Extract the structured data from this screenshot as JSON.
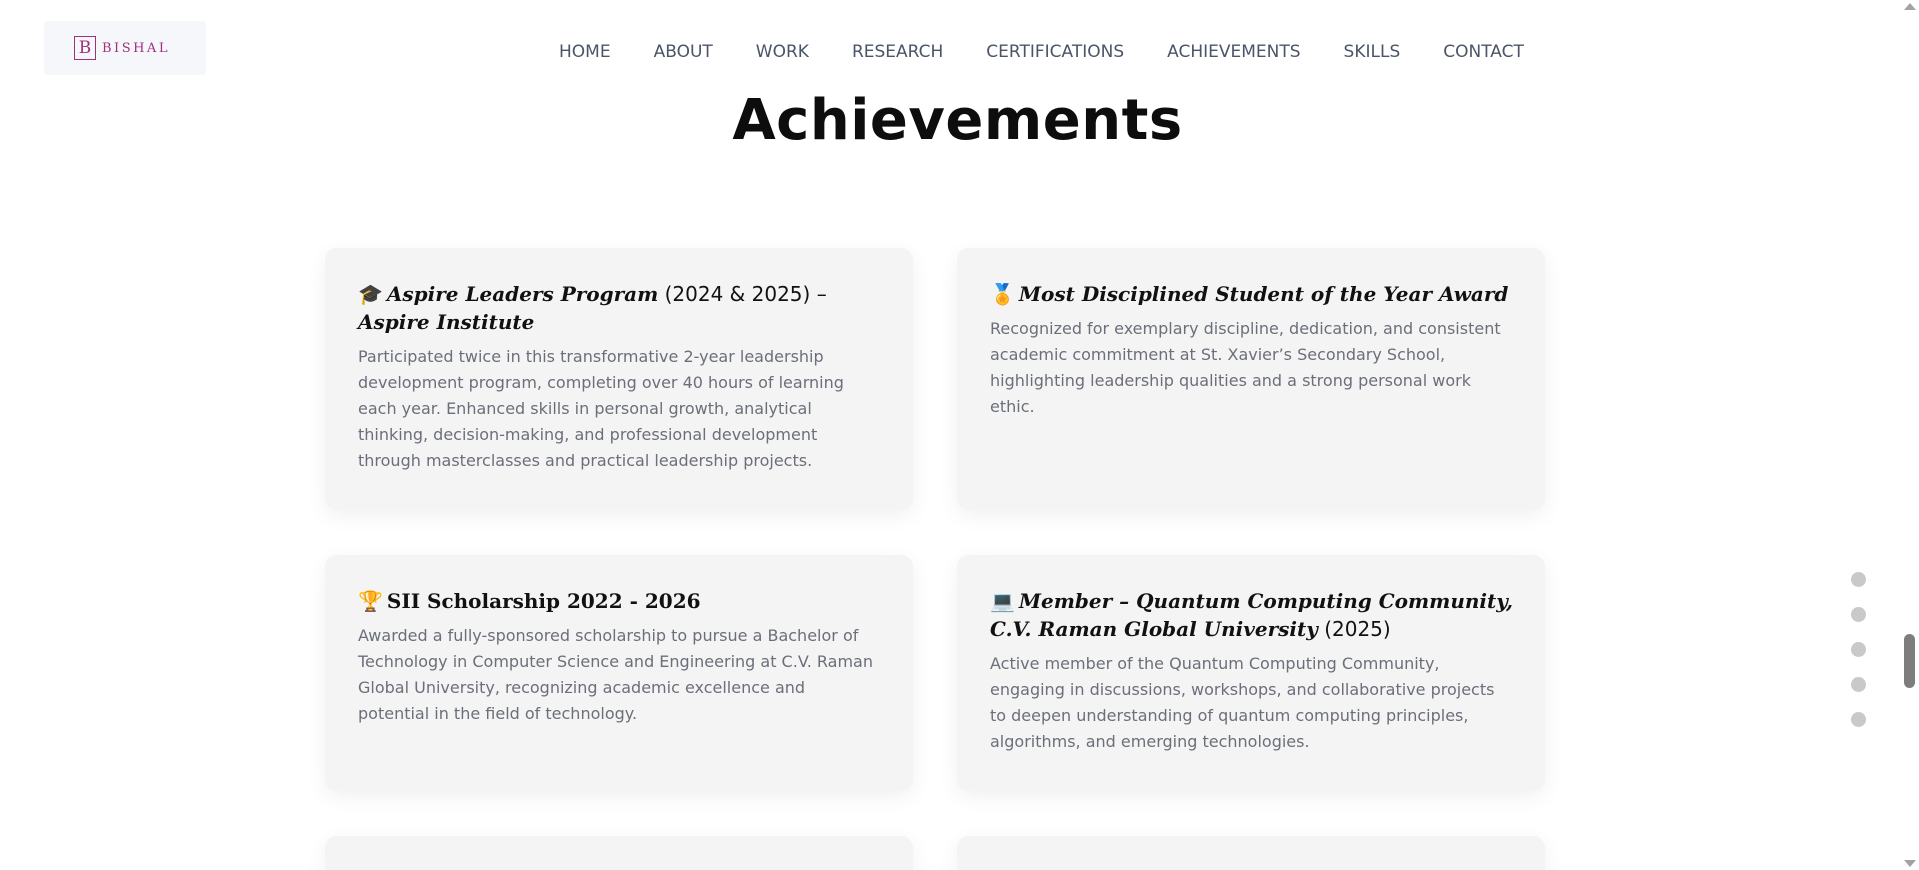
{
  "logo": {
    "letter": "B",
    "text": "BISHAL"
  },
  "nav": {
    "items": [
      "HOME",
      "ABOUT",
      "WORK",
      "RESEARCH",
      "CERTIFICATIONS",
      "ACHIEVEMENTS",
      "SKILLS",
      "CONTACT"
    ]
  },
  "section": {
    "title": "Achievements"
  },
  "cards": [
    {
      "emoji": "🎓",
      "title_italic": "Aspire Leaders Program",
      "title_plain": " (2024 & 2025) –",
      "title_italic2": "Aspire Institute",
      "description": "Participated twice in this transformative 2-year leadership development program, completing over 40 hours of learning each year. Enhanced skills in personal growth, analytical thinking, decision-making, and professional development through masterclasses and practical leadership projects."
    },
    {
      "emoji": "🏅",
      "title_italic": "Most Disciplined Student of the Year Award",
      "description": "Recognized for exemplary discipline, dedication, and consistent academic commitment at St. Xavier’s Secondary School, highlighting leadership qualities and a strong personal work ethic."
    },
    {
      "emoji": "🏆",
      "title_bold": "SII Scholarship 2022 - 2026",
      "description": "Awarded a fully-sponsored scholarship to pursue a Bachelor of Technology in Computer Science and Engineering at C.V. Raman Global University, recognizing academic excellence and potential in the field of technology."
    },
    {
      "emoji": "💻",
      "title_italic": "Member – Quantum Computing Community, C.V. Raman Global University",
      "title_plain": " (2025)",
      "description": "Active member of the Quantum Computing Community, engaging in discussions, workshops, and collaborative projects to deepen understanding of quantum computing principles, algorithms, and emerging technologies."
    }
  ],
  "page_dots": {
    "count": 5
  }
}
